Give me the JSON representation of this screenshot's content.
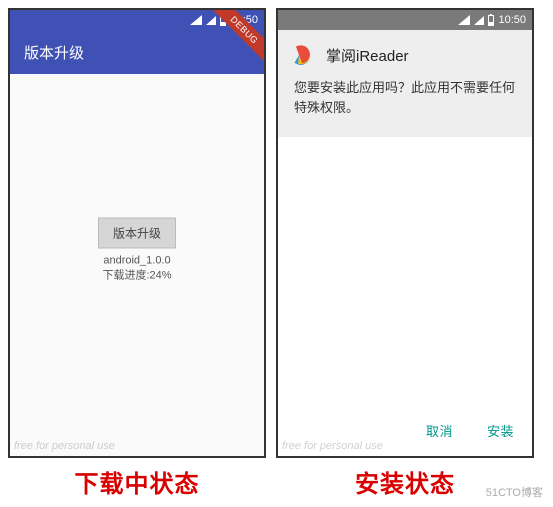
{
  "status_time": "10:50",
  "left": {
    "app_bar_title": "版本升级",
    "debug_label": "debug",
    "upgrade_button_label": "版本升级",
    "file_name": "android_1.0.0",
    "progress_text": "下载进度:24%",
    "watermark": "free for personal use",
    "caption": "下载中状态"
  },
  "right": {
    "app_name": "掌阅iReader",
    "install_message": "您要安装此应用吗？此应用不需要任何特殊权限。",
    "cancel_label": "取消",
    "install_label": "安装",
    "watermark": "free for personal use",
    "caption": "安装状态"
  },
  "attribution": "51CTO博客"
}
